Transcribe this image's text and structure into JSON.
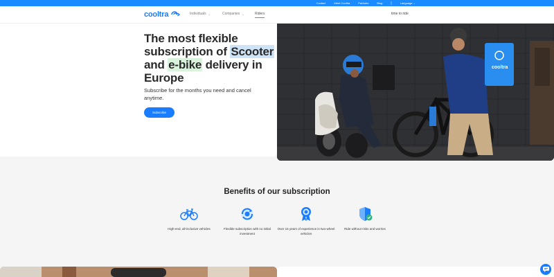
{
  "topbar": {
    "links": [
      "Contact",
      "Meet Cooltra",
      "Partners",
      "Blog"
    ],
    "language_label": "Language"
  },
  "nav": {
    "logo_text": "cooltra",
    "items": [
      {
        "label": "Individuals"
      },
      {
        "label": "Companies"
      },
      {
        "label": "Riders"
      }
    ],
    "right_text": "time to ride"
  },
  "hero": {
    "title_part1": "The most flexible subscription of ",
    "title_scooter": "Scooter",
    "title_and": " and ",
    "title_ebike": "e-bike",
    "title_part2": " delivery in Europe",
    "subtitle": "Subscribe for the months you need and cancel anytime.",
    "button_label": "Subscribe",
    "photo_badge": "cooltra"
  },
  "benefits": {
    "title": "Benefits of our subscription",
    "items": [
      {
        "icon": "bike-icon",
        "label": "High-end, all-inclusive vehicles"
      },
      {
        "icon": "refresh-icon",
        "label": "Flexible subscription with no initial investment"
      },
      {
        "icon": "award-icon",
        "label": "Over 15 years of experience in two-wheel vehicles"
      },
      {
        "icon": "shield-check-icon",
        "label": "Ride without risks and worries"
      }
    ]
  },
  "colors": {
    "brand_blue": "#1a7cff",
    "topbar_blue": "#1a8cff",
    "accent_green": "#2db47d",
    "highlight_blue": "#cfe3f7",
    "highlight_green": "#d9f3dd"
  }
}
